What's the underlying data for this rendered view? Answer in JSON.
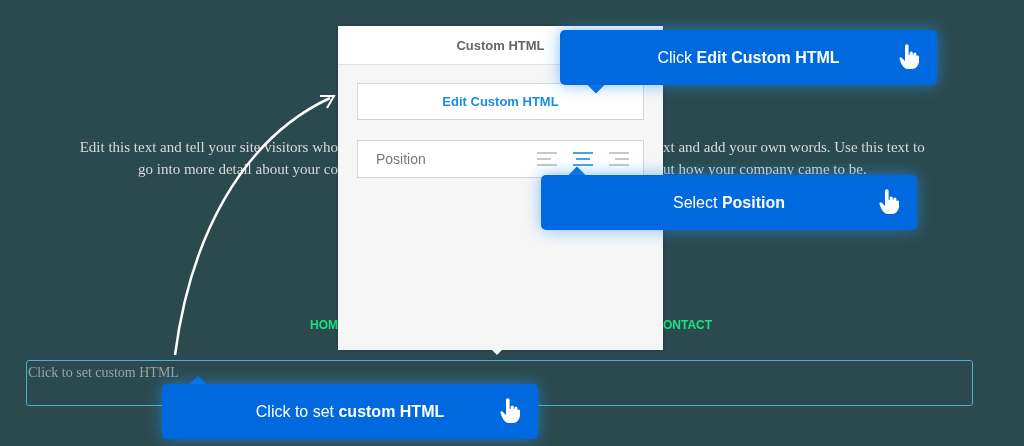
{
  "page": {
    "paragraph_left": [
      "Edit this text and tell your site visitors who",
      "go into more detail about your co"
    ],
    "paragraph_right": [
      "xt and add your own words. Use this text to",
      "ut how your company came to be."
    ],
    "nav_left": "HOM",
    "nav_right": "ONTACT",
    "html_box_placeholder": "Click to set custom HTML"
  },
  "panel": {
    "title": "Custom HTML",
    "edit_button": "Edit Custom HTML",
    "position_label": "Position",
    "align_options": [
      {
        "kind": "left",
        "selected": false
      },
      {
        "kind": "center",
        "selected": true
      },
      {
        "kind": "right",
        "selected": false
      }
    ]
  },
  "tooltips": [
    {
      "text": "Click **Edit Custom HTML**",
      "kind": "above"
    },
    {
      "text": "Select **Position**",
      "kind": "below"
    },
    {
      "text": "Click to set **custom HTML**",
      "kind": "below"
    }
  ]
}
